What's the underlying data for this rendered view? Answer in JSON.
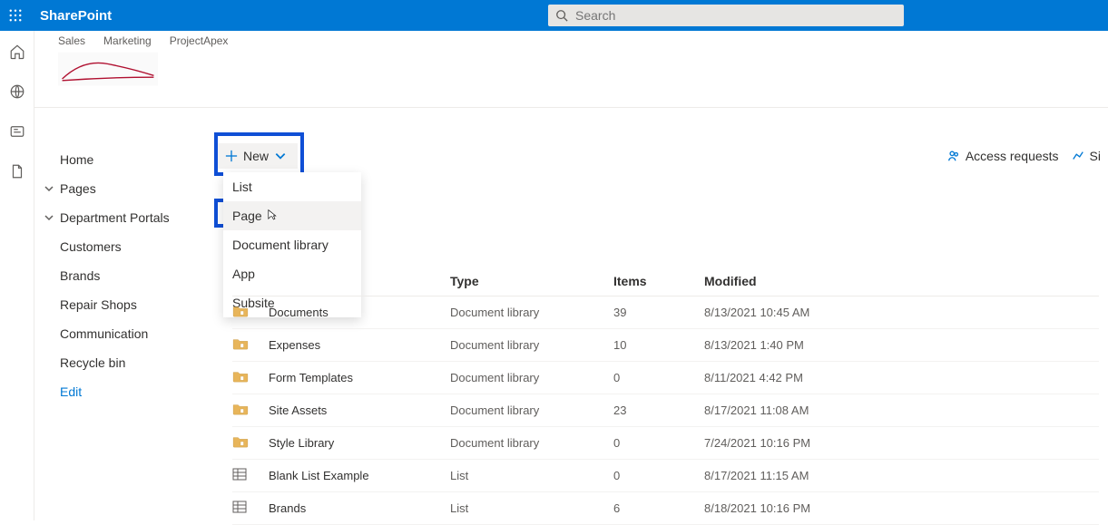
{
  "topbar": {
    "brand": "SharePoint",
    "search_placeholder": "Search"
  },
  "header": {
    "links": [
      "Sales",
      "Marketing",
      "ProjectApex"
    ]
  },
  "leftnav": {
    "home": "Home",
    "pages": "Pages",
    "dept": "Department Portals",
    "customers": "Customers",
    "brands": "Brands",
    "repair": "Repair Shops",
    "comm": "Communication",
    "recycle": "Recycle bin",
    "edit": "Edit"
  },
  "cmdbar": {
    "new_label": "New",
    "access_label": "Access requests",
    "site_label": "Si"
  },
  "dropdown": {
    "list": "List",
    "page": "Page",
    "doclib": "Document library",
    "app": "App",
    "subsite": "Subsite"
  },
  "grid": {
    "headers": {
      "type": "Type",
      "items": "Items",
      "modified": "Modified"
    },
    "rows": [
      {
        "icon": "folder",
        "name": "Documents",
        "type": "Document library",
        "items": "39",
        "mod": "8/13/2021 10:45 AM"
      },
      {
        "icon": "folder",
        "name": "Expenses",
        "type": "Document library",
        "items": "10",
        "mod": "8/13/2021 1:40 PM"
      },
      {
        "icon": "folder",
        "name": "Form Templates",
        "type": "Document library",
        "items": "0",
        "mod": "8/11/2021 4:42 PM"
      },
      {
        "icon": "folder",
        "name": "Site Assets",
        "type": "Document library",
        "items": "23",
        "mod": "8/17/2021 11:08 AM"
      },
      {
        "icon": "folder",
        "name": "Style Library",
        "type": "Document library",
        "items": "0",
        "mod": "7/24/2021 10:16 PM"
      },
      {
        "icon": "list",
        "name": "Blank List Example",
        "type": "List",
        "items": "0",
        "mod": "8/17/2021 11:15 AM"
      },
      {
        "icon": "list",
        "name": "Brands",
        "type": "List",
        "items": "6",
        "mod": "8/18/2021 10:16 PM"
      }
    ]
  }
}
